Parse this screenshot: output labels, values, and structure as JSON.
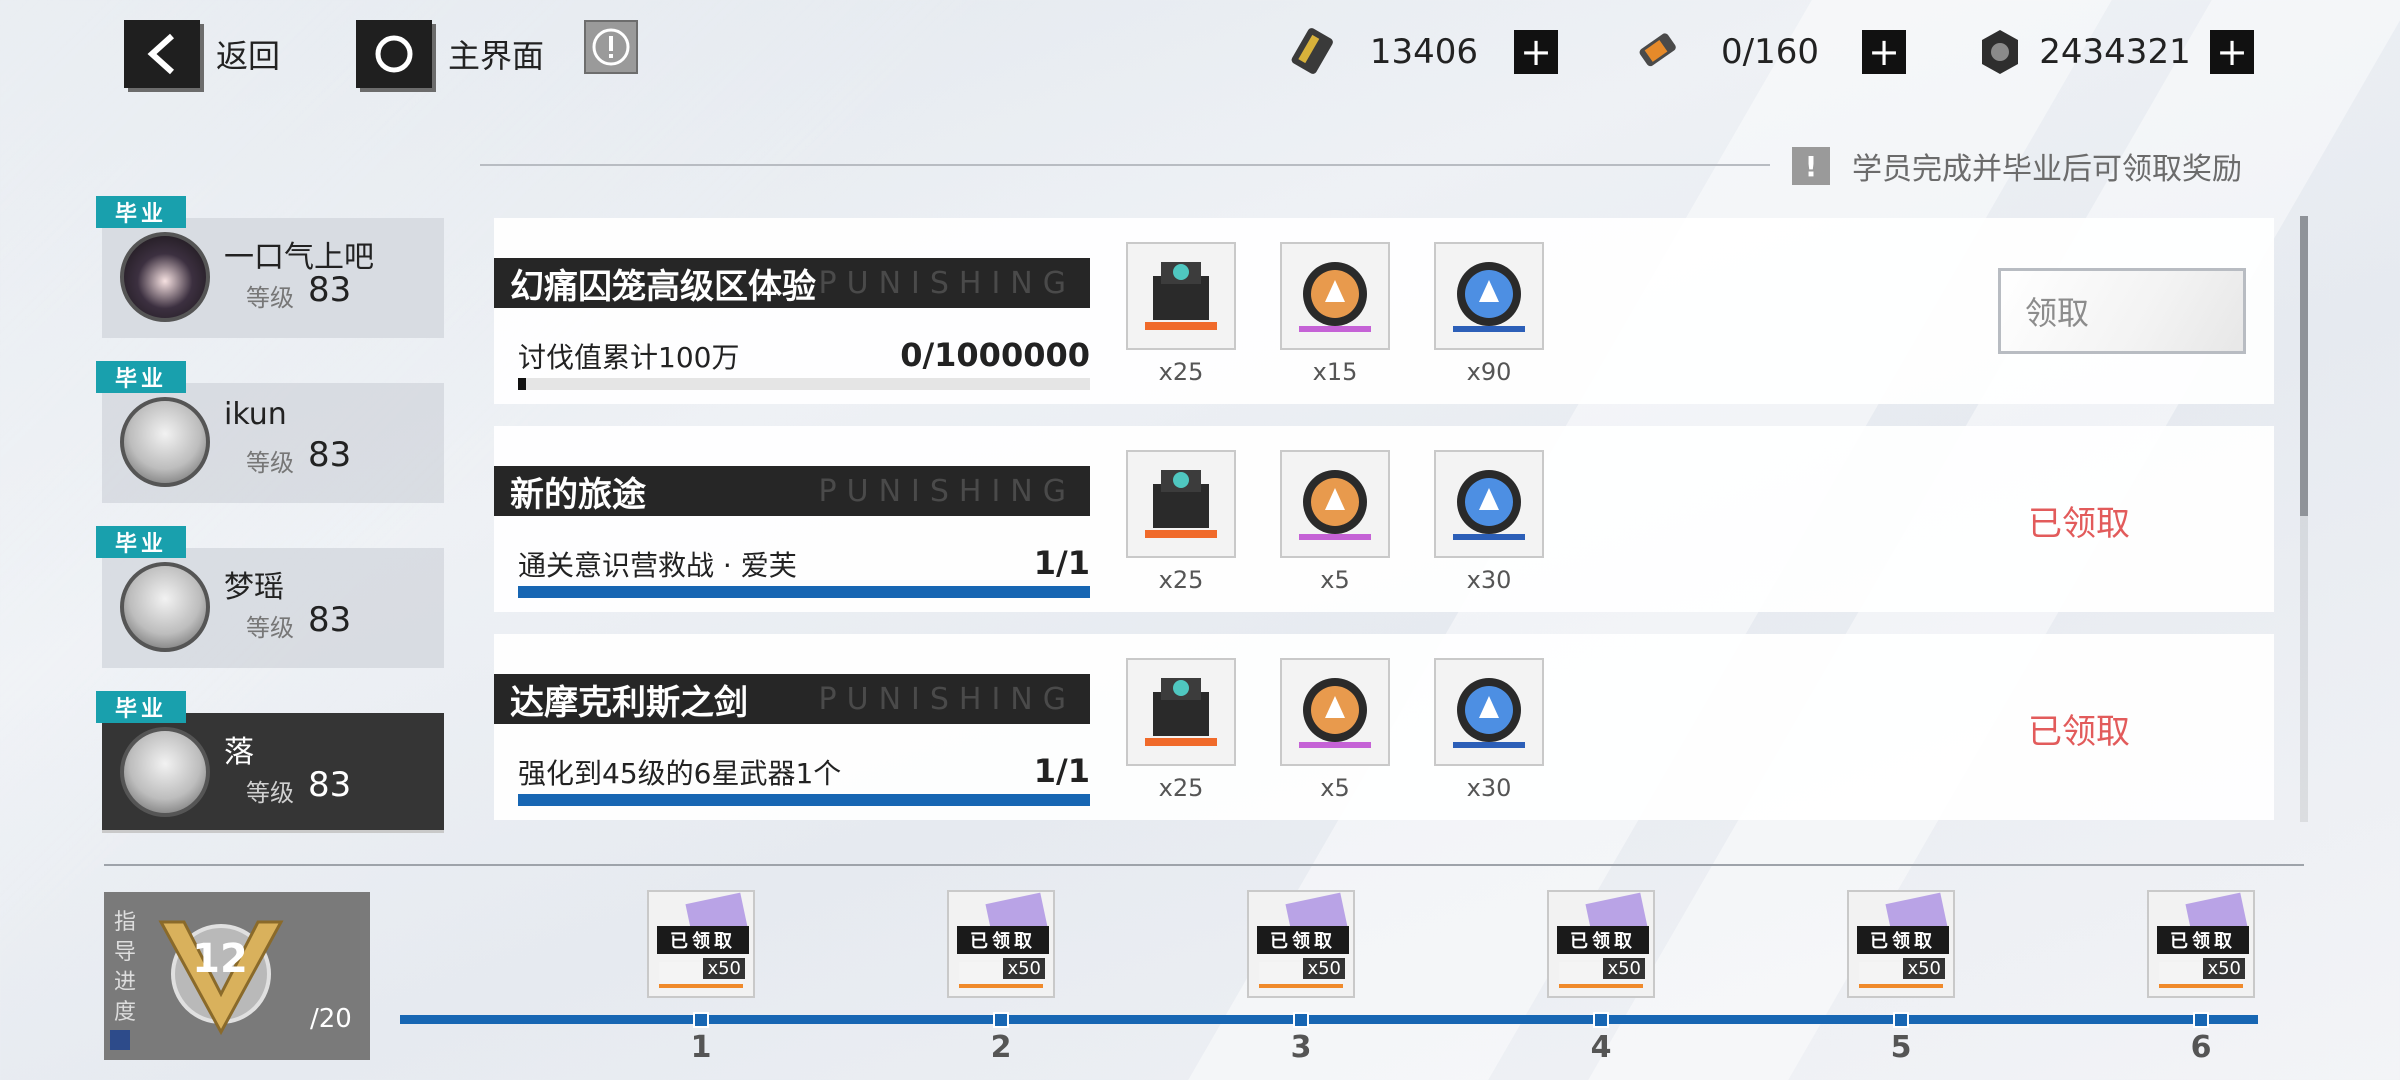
{
  "topbar": {
    "back_label": "返回",
    "home_label": "主界面",
    "info_icon": "exclamation-icon",
    "resources": [
      {
        "name": "ticket-icon",
        "value": "13406"
      },
      {
        "name": "battery-icon",
        "value": "0/160"
      },
      {
        "name": "coin-icon",
        "value": "2434321"
      }
    ]
  },
  "hint": {
    "text": "学员完成并毕业后可领取奖励"
  },
  "students": [
    {
      "tag": "毕业",
      "name": "一口气上吧",
      "level_label": "等级",
      "level": "83",
      "active": false
    },
    {
      "tag": "毕业",
      "name": "ikun",
      "level_label": "等级",
      "level": "83",
      "active": false
    },
    {
      "tag": "毕业",
      "name": "梦瑶",
      "level_label": "等级",
      "level": "83",
      "active": false
    },
    {
      "tag": "毕业",
      "name": "落",
      "level_label": "等级",
      "level": "83",
      "active": true
    }
  ],
  "tasks": [
    {
      "title": "幻痛囚笼高级区体验",
      "watermark": "PUNISHING",
      "description": "讨伐值累计100万",
      "progress_text": "0/1000000",
      "progress": 0.0,
      "rewards": [
        {
          "icon": "supply-crate-icon",
          "count": "x25"
        },
        {
          "icon": "orange-coin-icon",
          "count": "x15"
        },
        {
          "icon": "blue-coin-icon",
          "count": "x90"
        }
      ],
      "status": "claim",
      "status_text": "领取"
    },
    {
      "title": "新的旅途",
      "watermark": "PUNISHING",
      "description": "通关意识营救战 · 爱芙",
      "progress_text": "1/1",
      "progress": 1.0,
      "rewards": [
        {
          "icon": "supply-crate-icon",
          "count": "x25"
        },
        {
          "icon": "orange-coin-icon",
          "count": "x5"
        },
        {
          "icon": "blue-coin-icon",
          "count": "x30"
        }
      ],
      "status": "claimed",
      "status_text": "已领取"
    },
    {
      "title": "达摩克利斯之剑",
      "watermark": "PUNISHING",
      "description": "强化到45级的6星武器1个",
      "progress_text": "1/1",
      "progress": 1.0,
      "rewards": [
        {
          "icon": "supply-crate-icon",
          "count": "x25"
        },
        {
          "icon": "orange-coin-icon",
          "count": "x5"
        },
        {
          "icon": "blue-coin-icon",
          "count": "x30"
        }
      ],
      "status": "claimed",
      "status_text": "已领取"
    }
  ],
  "guidance": {
    "label": "指导进度",
    "current": "12",
    "total": "/20",
    "milestones": [
      {
        "index": "1",
        "stamp": "已领取",
        "qty": "x50"
      },
      {
        "index": "2",
        "stamp": "已领取",
        "qty": "x50"
      },
      {
        "index": "3",
        "stamp": "已领取",
        "qty": "x50"
      },
      {
        "index": "4",
        "stamp": "已领取",
        "qty": "x50"
      },
      {
        "index": "5",
        "stamp": "已领取",
        "qty": "x50"
      },
      {
        "index": "6",
        "stamp": "已领取",
        "qty": "x50"
      }
    ]
  },
  "colors": {
    "accent_blue": "#1766b3",
    "graduate_teal": "#19a0ad",
    "claimed_red": "#e25b5b"
  }
}
